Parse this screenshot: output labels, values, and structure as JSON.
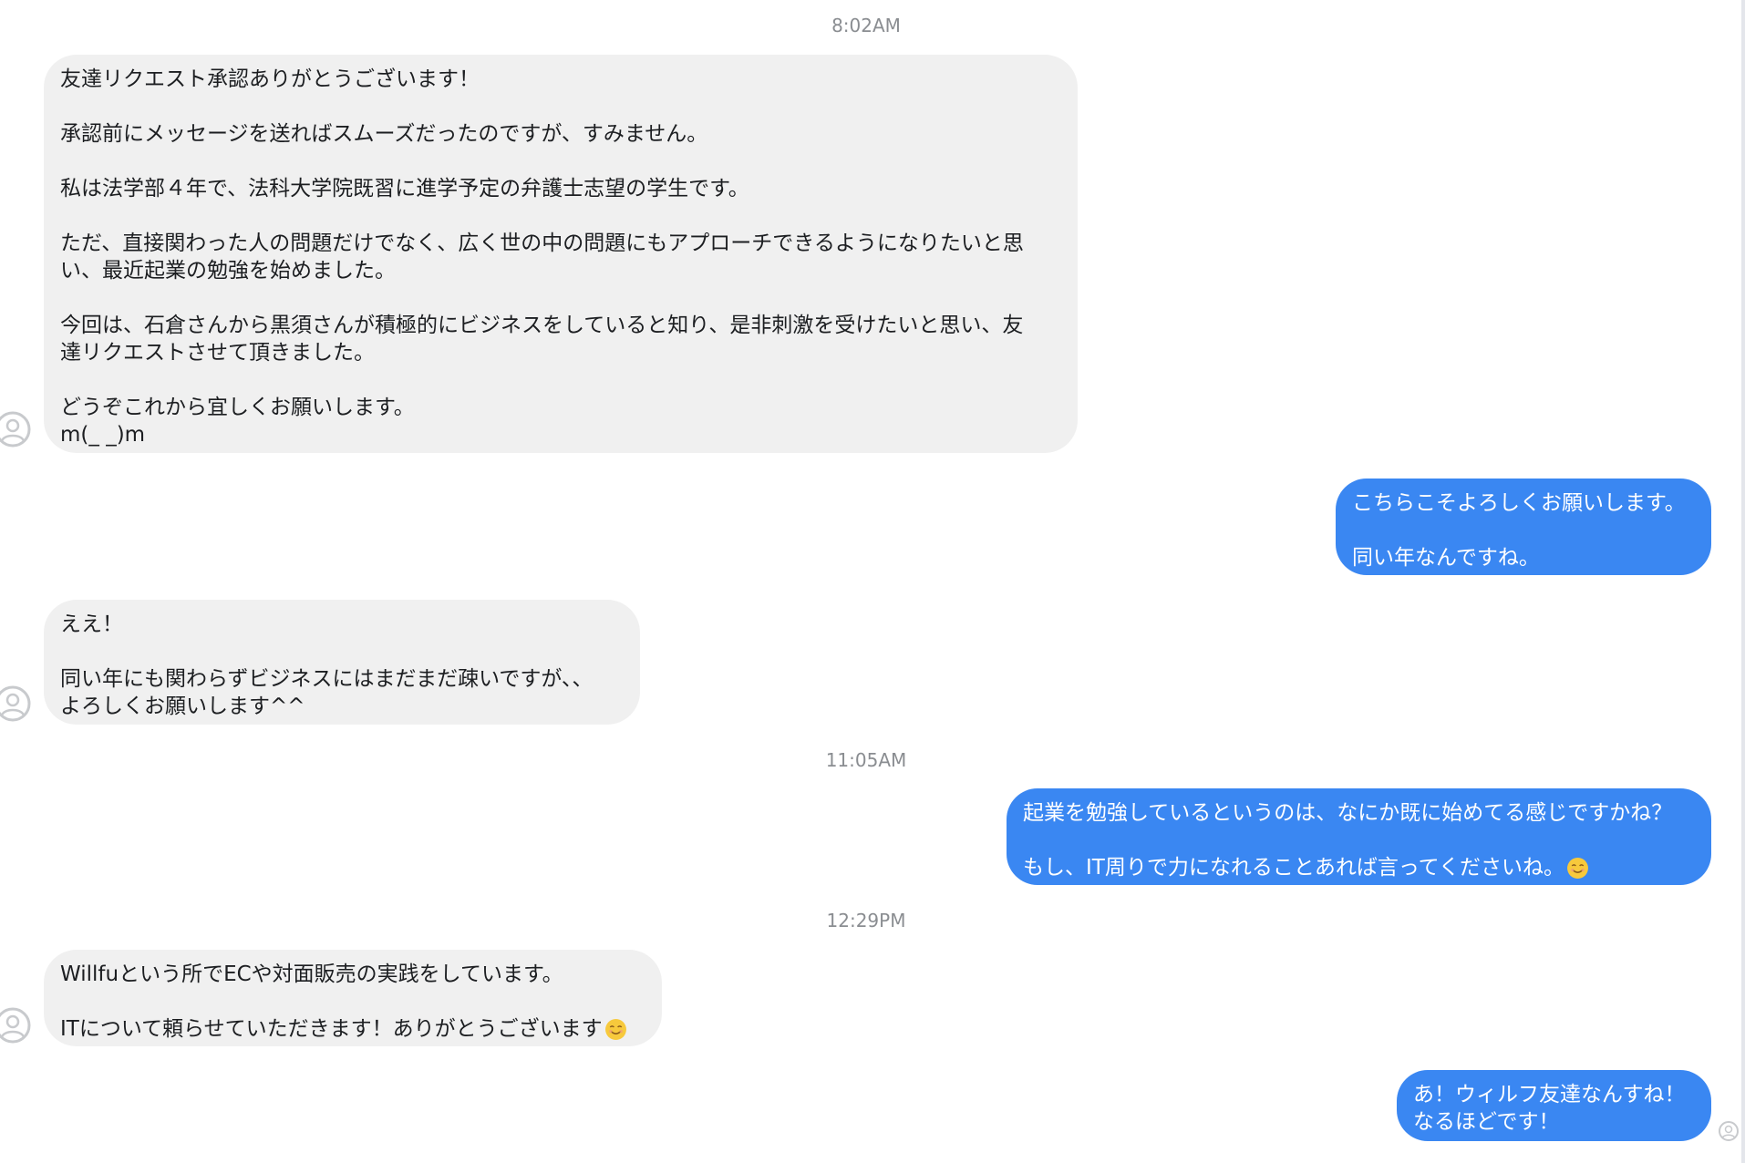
{
  "timestamps": [
    "8:02AM",
    "11:05AM",
    "12:29PM"
  ],
  "messages": [
    {
      "lines": [
        "友達リクエスト承認ありがとうございます！",
        "",
        "承認前にメッセージを送ればスムーズだったのですが、すみません。",
        "",
        "私は法学部４年で、法科大学院既習に進学予定の弁護士志望の学生です。",
        "",
        "ただ、直接関わった人の問題だけでなく、広く世の中の問題にもアプローチできるようになりたいと思",
        "い、最近起業の勉強を始めました。",
        "",
        "今回は、石倉さんから黒須さんが積極的にビジネスをしていると知り、是非刺激を受けたいと思い、友",
        "達リクエストさせて頂きました。",
        "",
        "どうぞこれから宜しくお願いします。",
        "m(_ _)m"
      ]
    },
    {
      "lines": [
        "こちらこそよろしくお願いします。",
        "",
        "同い年なんですね。"
      ]
    },
    {
      "lines": [
        "ええ！",
        "",
        "同い年にも関わらずビジネスにはまだまだ疎いですが、、",
        "よろしくお願いします^^"
      ]
    },
    {
      "lines": [
        "起業を勉強しているというのは、なにか既に始めてる感じですかね？",
        "",
        "もし、IT周りで力になれることあれば言ってくださいね。"
      ],
      "emoji": "smiling-face-emoji"
    },
    {
      "lines": [
        "Willfuという所でECや対面販売の実践をしています。",
        "",
        "ITについて頼らせていただきます！ありがとうございます"
      ],
      "emoji": "smiling-face-emoji"
    },
    {
      "lines": [
        "あ！ウィルフ友達なんすね！",
        "なるほどです！"
      ]
    }
  ],
  "colors": {
    "incoming_bubble": "#f0f0f0",
    "outgoing_bubble": "#3a87f2",
    "timestamp_text": "#8a8d91"
  }
}
